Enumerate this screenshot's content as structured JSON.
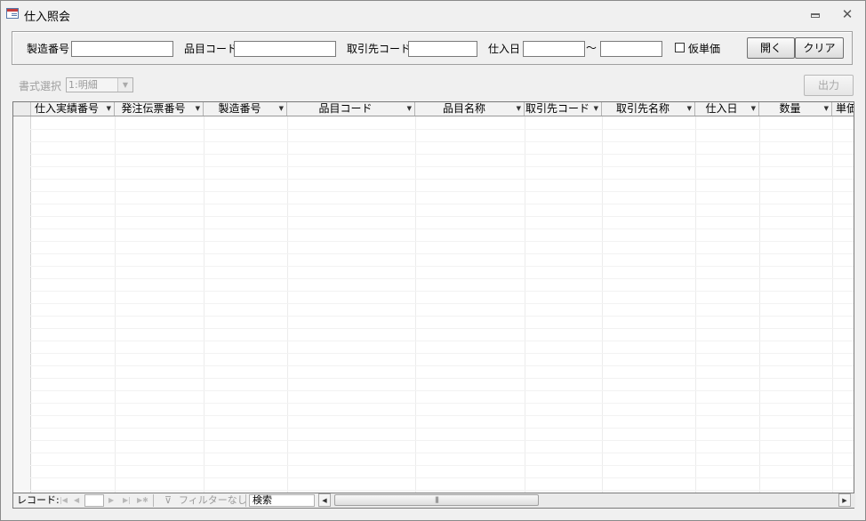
{
  "window": {
    "title": "仕入照会"
  },
  "filters": {
    "seizo_bango_label": "製造番号",
    "seizo_bango_value": "",
    "hinmoku_code_label": "品目コード",
    "hinmoku_code_value": "",
    "torihikisaki_code_label": "取引先コード",
    "torihikisaki_code_value": "",
    "shiire_bi_label": "仕入日",
    "shiire_bi_from": "",
    "range_sep": "～",
    "shiire_bi_to": "",
    "kari_tanka_label": "仮単価",
    "kari_tanka_checked": false,
    "open_button": "開く",
    "clear_button": "クリア"
  },
  "format": {
    "label": "書式選択",
    "selected": "1:明細",
    "output_button": "出力"
  },
  "grid": {
    "columns": [
      "仕入実績番号",
      "発注伝票番号",
      "製造番号",
      "品目コード",
      "品目名称",
      "取引先コード",
      "取引先名称",
      "仕入日",
      "数量",
      "単価"
    ],
    "rows": []
  },
  "statusbar": {
    "record_label": "レコード:",
    "record_value": "",
    "filter_label": "フィルターなし",
    "search_placeholder": "検索"
  }
}
